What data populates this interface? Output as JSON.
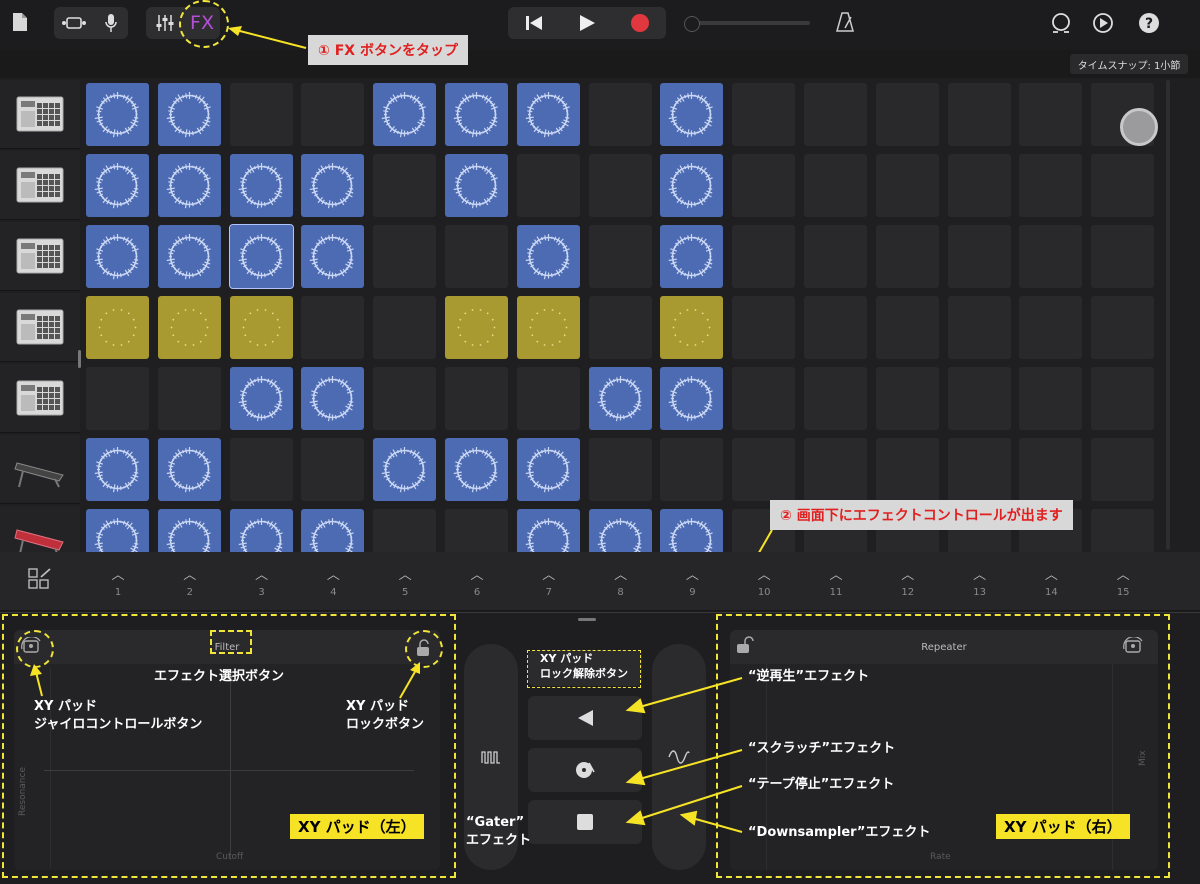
{
  "toolbar": {
    "fx_label": "FX",
    "callout_fx": "① FX ボタンをタップ",
    "time_snap": "タイムスナップ: 1小節"
  },
  "instruments": [
    "drum-machine",
    "drum-machine",
    "drum-machine",
    "drum-machine",
    "drum-machine",
    "keyboard-synth",
    "keyboard-red"
  ],
  "grid": {
    "rows": [
      [
        "blue",
        "blue",
        "empty",
        "empty",
        "blue",
        "blue",
        "blue",
        "empty",
        "blue",
        "empty",
        "empty",
        "empty",
        "empty",
        "empty",
        "empty"
      ],
      [
        "blue",
        "blue",
        "blue",
        "blue",
        "empty",
        "blue",
        "empty",
        "empty",
        "blue",
        "empty",
        "empty",
        "empty",
        "empty",
        "empty",
        "empty"
      ],
      [
        "blue",
        "blue",
        "blue",
        "blue",
        "empty",
        "empty",
        "blue",
        "empty",
        "blue",
        "empty",
        "empty",
        "empty",
        "empty",
        "empty",
        "empty"
      ],
      [
        "yellow",
        "yellow",
        "yellow",
        "empty",
        "empty",
        "yellow",
        "yellow",
        "empty",
        "yellow",
        "empty",
        "empty",
        "empty",
        "empty",
        "empty",
        "empty"
      ],
      [
        "empty",
        "empty",
        "blue",
        "blue",
        "empty",
        "empty",
        "empty",
        "blue",
        "blue",
        "empty",
        "empty",
        "empty",
        "empty",
        "empty",
        "empty"
      ],
      [
        "blue",
        "blue",
        "empty",
        "empty",
        "blue",
        "blue",
        "blue",
        "empty",
        "empty",
        "empty",
        "empty",
        "empty",
        "empty",
        "empty",
        "empty"
      ],
      [
        "blue",
        "blue",
        "blue",
        "blue",
        "empty",
        "empty",
        "blue",
        "blue",
        "blue",
        "empty",
        "empty",
        "empty",
        "empty",
        "empty",
        "empty"
      ]
    ],
    "selected_cell": "row3-col3"
  },
  "columns": [
    "1",
    "2",
    "3",
    "4",
    "5",
    "6",
    "7",
    "8",
    "9",
    "10",
    "11",
    "12",
    "13",
    "14",
    "15"
  ],
  "callout_controls": "② 画面下にエフェクトコントロールが出ます",
  "left_pad": {
    "header": "Filter",
    "x_axis": "Cutoff",
    "y_axis": "Resonance",
    "label": "XY パッド（左）"
  },
  "right_pad": {
    "header": "Repeater",
    "x_axis": "Rate",
    "y_axis": "Mix",
    "label": "XY パッド（右）"
  },
  "annotations": {
    "effect_select": "エフェクト選択ボタン",
    "gyro_line1": "XY パッド",
    "gyro_line2": "ジャイロコントロールボタン",
    "lock_line1": "XY パッド",
    "lock_line2": "ロックボタン",
    "unlock_line1": "XY パッド",
    "unlock_line2": "ロック解除ボタン",
    "reverse": "“逆再生”エフェクト",
    "scratch": "“スクラッチ”エフェクト",
    "tape_stop": "“テープ停止”エフェクト",
    "downsampler": "“Downsampler”エフェクト",
    "gater_line1": "“Gater”",
    "gater_line2": "エフェクト"
  },
  "colors": {
    "accent_yellow": "#f7e326",
    "fx_purple": "#b44fd6",
    "record_red": "#e0383e",
    "cell_blue": "#4d6bb3",
    "cell_yellow": "#a89a30"
  }
}
